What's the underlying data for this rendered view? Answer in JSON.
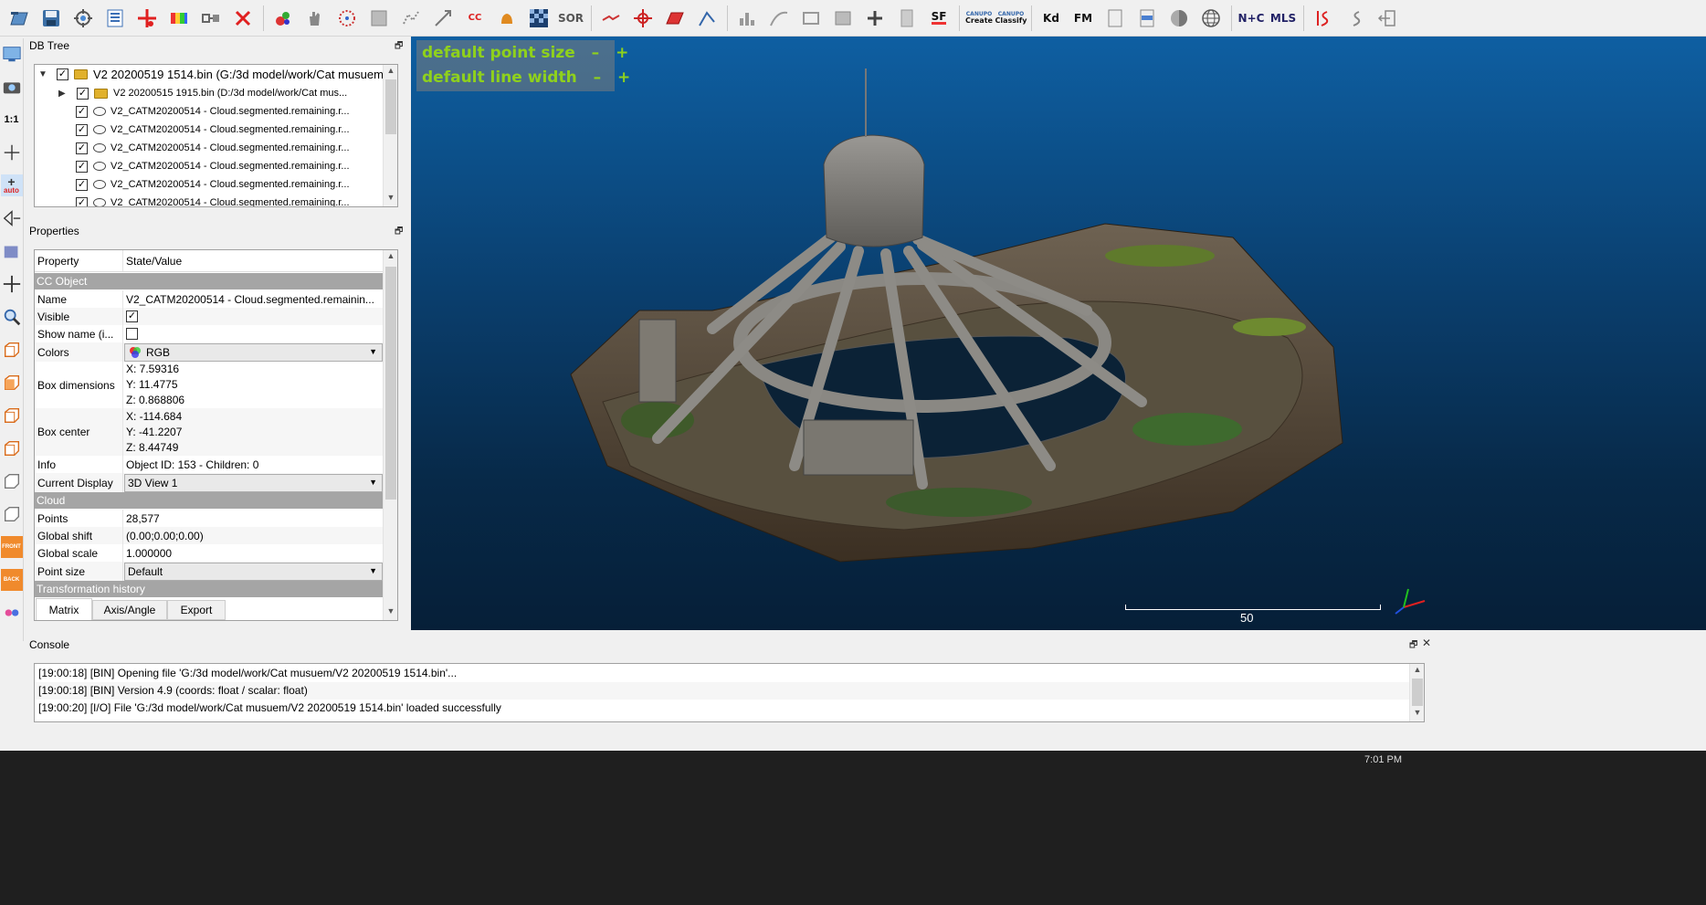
{
  "toolbar": {
    "icons": [
      "open-icon",
      "save-icon",
      "settings-icon",
      "list-icon",
      "add-point-icon",
      "rainbow-icon",
      "link-icon",
      "delete-icon",
      "color-icon",
      "hand-icon",
      "dots-icon",
      "sphere-icon",
      "noise-icon",
      "filter-icon",
      "cc-icon",
      "bell-icon",
      "checker-icon",
      "sor-icon",
      "segment-icon",
      "compass-icon",
      "plane-icon",
      "align-icon",
      "histogram-icon",
      "curve-icon",
      "max-icon",
      "stack-icon",
      "plus-icon",
      "calc-icon",
      "sf-icon",
      "canupo-create-icon",
      "canupo-classify-icon",
      "kd-icon",
      "fm-icon",
      "bsp-icon",
      "csv-icon",
      "shade-icon",
      "globe-icon",
      "nc-icon",
      "mls-icon",
      "s-red-icon",
      "s-gray-icon",
      "arrows-icon"
    ],
    "sor_label": "SOR",
    "sf_label": "SF",
    "canupo_create_label": "Create",
    "canupo_classify_label": "Classify",
    "canupo_label": "CANUPO",
    "kd_label": "Kd",
    "fm_label": "FM",
    "nc_label": "N+C",
    "mls_label": "MLS",
    "cc_label": "CC"
  },
  "left_toolbar": {
    "one_to_one_label": "1:1",
    "auto_label": "auto",
    "front_label": "FRONT",
    "back_label": "BACK"
  },
  "db_tree": {
    "title": "DB Tree",
    "items": [
      {
        "label": "V2 20200519 1514.bin (G:/3d model/work/Cat musuem)",
        "type": "folder",
        "expanded": true
      },
      {
        "label": "V2 20200515 1915.bin (D:/3d model/work/Cat mus...",
        "type": "folder",
        "expanded": false
      },
      {
        "label": "V2_CATM20200514 - Cloud.segmented.remaining.r...",
        "type": "cloud"
      },
      {
        "label": "V2_CATM20200514 - Cloud.segmented.remaining.r...",
        "type": "cloud"
      },
      {
        "label": "V2_CATM20200514 - Cloud.segmented.remaining.r...",
        "type": "cloud"
      },
      {
        "label": "V2_CATM20200514 - Cloud.segmented.remaining.r...",
        "type": "cloud"
      },
      {
        "label": "V2_CATM20200514 - Cloud.segmented.remaining.r...",
        "type": "cloud"
      },
      {
        "label": "V2_CATM20200514 - Cloud.segmented.remaining.r...",
        "type": "cloud"
      }
    ]
  },
  "properties": {
    "title": "Properties",
    "header_property": "Property",
    "header_value": "State/Value",
    "section_ccobject": "CC Object",
    "name_label": "Name",
    "name_value": "V2_CATM20200514 - Cloud.segmented.remainin...",
    "visible_label": "Visible",
    "showname_label": "Show name (i...",
    "colors_label": "Colors",
    "colors_value": "RGB",
    "boxdim_label": "Box dimensions",
    "boxdim_x": "X: 7.59316",
    "boxdim_y": "Y: 11.4775",
    "boxdim_z": "Z: 0.868806",
    "boxcenter_label": "Box center",
    "boxcenter_x": "X: -114.684",
    "boxcenter_y": "Y: -41.2207",
    "boxcenter_z": "Z: 8.44749",
    "info_label": "Info",
    "info_value": "Object ID: 153 - Children: 0",
    "display_label": "Current Display",
    "display_value": "3D View 1",
    "section_cloud": "Cloud",
    "points_label": "Points",
    "points_value": "28,577",
    "gshift_label": "Global shift",
    "gshift_value": "(0.00;0.00;0.00)",
    "gscale_label": "Global scale",
    "gscale_value": "1.000000",
    "psize_label": "Point size",
    "psize_value": "Default",
    "section_transform": "Transformation history",
    "tabs": [
      "Matrix",
      "Axis/Angle",
      "Export"
    ]
  },
  "view3d": {
    "point_size_label": "default point size",
    "line_width_label": "default line width",
    "minus": "–",
    "plus": "+",
    "scale_label": "50"
  },
  "console": {
    "title": "Console",
    "lines": [
      "[19:00:18] [BIN] Opening file 'G:/3d model/work/Cat musuem/V2 20200519 1514.bin'...",
      "[19:00:18] [BIN] Version 4.9 (coords: float / scalar: float)",
      "[19:00:20] [I/O] File 'G:/3d model/work/Cat musuem/V2 20200519 1514.bin' loaded successfully"
    ]
  },
  "taskbar": {
    "clock": "7:01 PM"
  },
  "colors": {
    "overlay_text": "#8fd11c",
    "section_bg": "#a5a5a5",
    "view_top": "#0e5fa2",
    "view_bottom": "#061f38"
  }
}
